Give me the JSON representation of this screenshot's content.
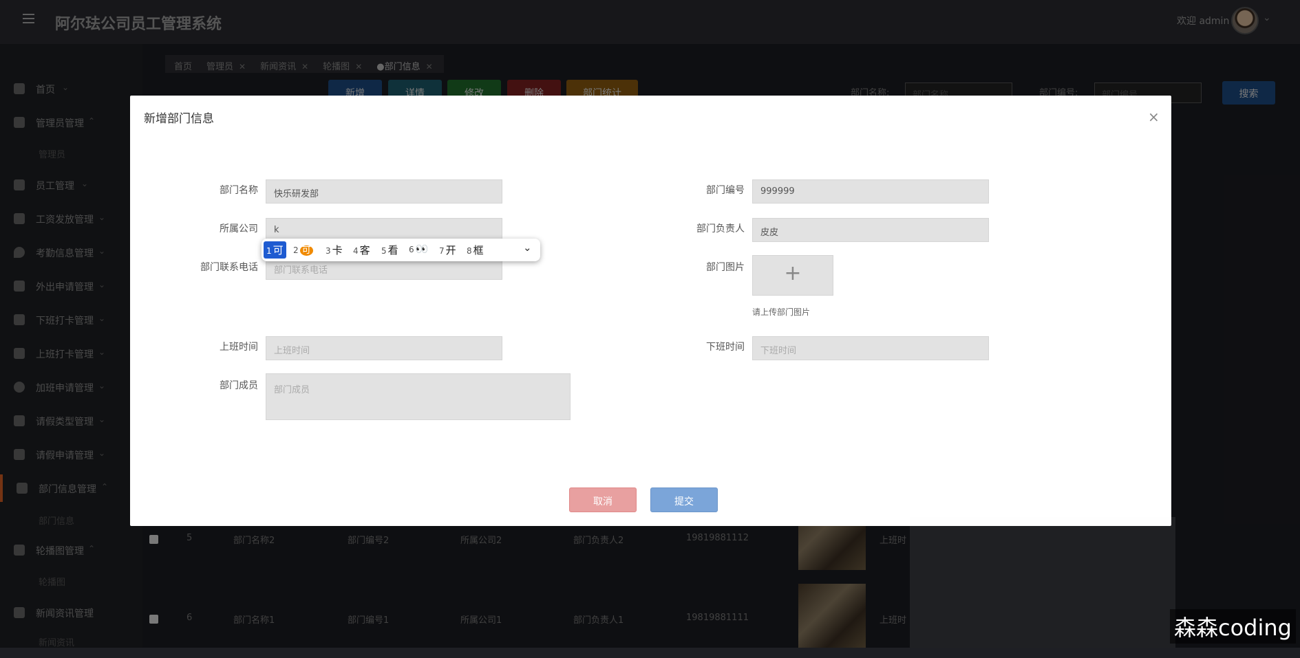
{
  "header": {
    "title": "阿尔珐公司员工管理系统",
    "welcome": "欢迎 admin"
  },
  "sidebar": {
    "items": [
      {
        "label": "首页",
        "arrow": "⌄"
      },
      {
        "label": "管理员管理",
        "arrow": "⌃"
      },
      {
        "label": "员工管理",
        "arrow": "⌄"
      },
      {
        "label": "工资发放管理",
        "arrow": "⌄"
      },
      {
        "label": "考勤信息管理",
        "arrow": "⌄"
      },
      {
        "label": "外出申请管理",
        "arrow": "⌄"
      },
      {
        "label": "下班打卡管理",
        "arrow": "⌄"
      },
      {
        "label": "上班打卡管理",
        "arrow": "⌄"
      },
      {
        "label": "加班申请管理",
        "arrow": "⌄"
      },
      {
        "label": "请假类型管理",
        "arrow": "⌄"
      },
      {
        "label": "请假申请管理",
        "arrow": "⌄"
      },
      {
        "label": "部门信息管理",
        "arrow": "⌃"
      },
      {
        "label": "轮播图管理",
        "arrow": "⌃"
      },
      {
        "label": "新闻资讯管理",
        "arrow": "⌃"
      }
    ],
    "subitems": {
      "admin": "管理员",
      "department": "部门信息",
      "carousel": "轮播图",
      "news": "新闻资讯"
    }
  },
  "tabs": [
    {
      "label": "首页",
      "closable": false
    },
    {
      "label": "管理员",
      "closable": true
    },
    {
      "label": "新闻资讯",
      "closable": true
    },
    {
      "label": "轮播图",
      "closable": true
    },
    {
      "label": "●部门信息",
      "closable": true
    }
  ],
  "toolbar": {
    "add": "新增",
    "detail": "详情",
    "edit": "修改",
    "delete": "删除",
    "stats": "部门统计",
    "colors": {
      "add": "#1d4a80",
      "detail": "#1d5a6a",
      "edit": "#1f6b2b",
      "delete": "#7a2020",
      "stats": "#8a5a10"
    }
  },
  "search": {
    "name_label": "部门名称:",
    "name_placeholder": "部门名称",
    "code_label": "部门编号:",
    "code_placeholder": "部门编号",
    "button": "搜索"
  },
  "table": {
    "rows": [
      {
        "index": "5",
        "name": "部门名称2",
        "code": "部门编号2",
        "company": "所属公司2",
        "manager": "部门负责人2",
        "phone": "19819881112",
        "start": "上班时"
      },
      {
        "index": "6",
        "name": "部门名称1",
        "code": "部门编号1",
        "company": "所属公司1",
        "manager": "部门负责人1",
        "phone": "19819881111",
        "start": "上班时"
      }
    ]
  },
  "dialog": {
    "title": "新增部门信息",
    "close": "×",
    "fields": {
      "name_label": "部门名称",
      "name_value": "快乐研发部",
      "code_label": "部门编号",
      "code_value": "999999",
      "company_label": "所属公司",
      "company_value": "k",
      "manager_label": "部门负责人",
      "manager_value": "皮皮",
      "phone_label": "部门联系电话",
      "phone_placeholder": "部门联系电话",
      "image_label": "部门图片",
      "image_hint": "请上传部门图片",
      "start_label": "上班时间",
      "start_placeholder": "上班时间",
      "end_label": "下班时间",
      "end_placeholder": "下班时间",
      "members_label": "部门成员",
      "members_placeholder": "部门成员"
    },
    "cancel": "取消",
    "submit": "提交"
  },
  "ime": {
    "candidates": [
      {
        "n": "1",
        "text": "可"
      },
      {
        "n": "2",
        "text": "可"
      },
      {
        "n": "3",
        "text": "卡"
      },
      {
        "n": "4",
        "text": "客"
      },
      {
        "n": "5",
        "text": "看"
      },
      {
        "n": "6",
        "text": "👀"
      },
      {
        "n": "7",
        "text": "开"
      },
      {
        "n": "8",
        "text": "框"
      }
    ]
  },
  "watermark": "森森coding"
}
